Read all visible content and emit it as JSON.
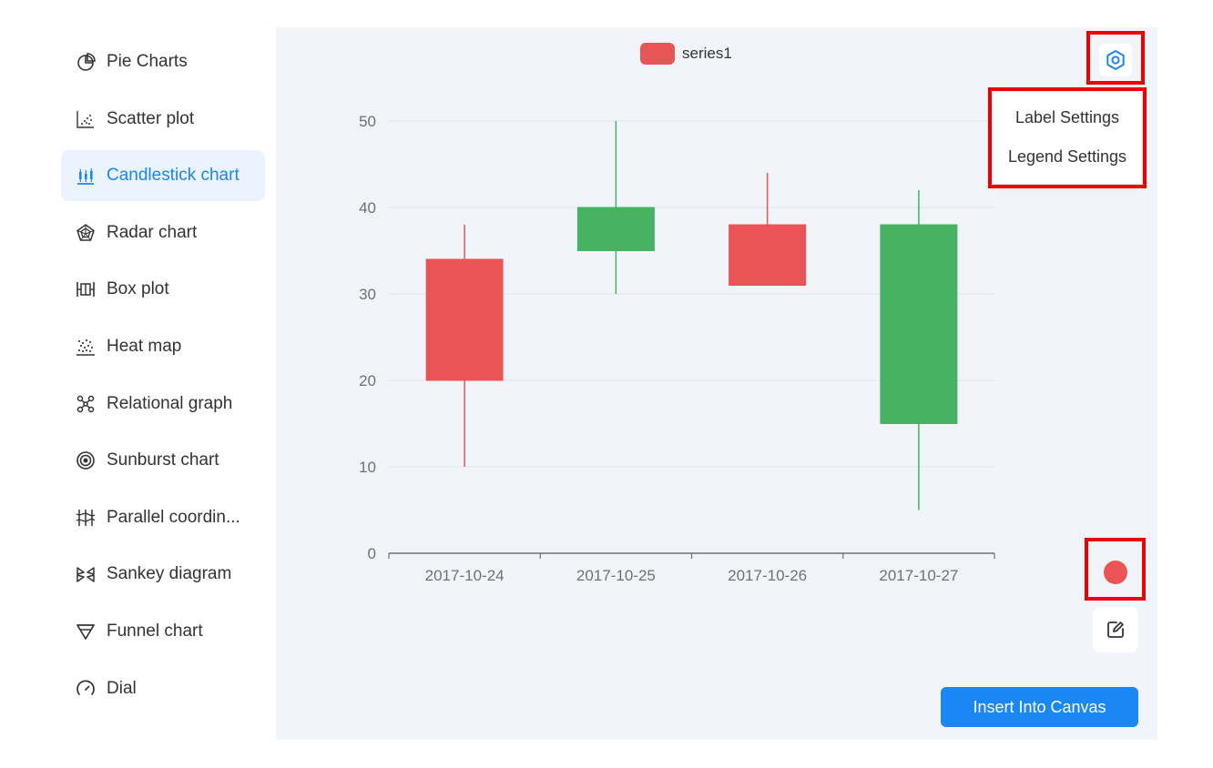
{
  "sidebar": {
    "items": [
      {
        "label": "Pie Charts",
        "icon": "pie-chart-icon",
        "active": false
      },
      {
        "label": "Scatter plot",
        "icon": "scatter-plot-icon",
        "active": false
      },
      {
        "label": "Candlestick chart",
        "icon": "candlestick-icon",
        "active": true
      },
      {
        "label": "Radar chart",
        "icon": "radar-chart-icon",
        "active": false
      },
      {
        "label": "Box plot",
        "icon": "box-plot-icon",
        "active": false
      },
      {
        "label": "Heat map",
        "icon": "heat-map-icon",
        "active": false
      },
      {
        "label": "Relational graph",
        "icon": "relational-graph-icon",
        "active": false
      },
      {
        "label": "Sunburst chart",
        "icon": "sunburst-icon",
        "active": false
      },
      {
        "label": "Parallel coordin...",
        "icon": "parallel-coordinates-icon",
        "active": false
      },
      {
        "label": "Sankey diagram",
        "icon": "sankey-icon",
        "active": false
      },
      {
        "label": "Funnel chart",
        "icon": "funnel-icon",
        "active": false
      },
      {
        "label": "Dial",
        "icon": "dial-icon",
        "active": false
      }
    ]
  },
  "settings_menu": {
    "label_settings": "Label Settings",
    "legend_settings": "Legend Settings"
  },
  "actions": {
    "insert_label": "Insert Into Canvas",
    "series_color": "#ea5455"
  },
  "colors": {
    "accent": "#1b87f5",
    "up": "#47b262",
    "down": "#eb5454",
    "highlight": "#ee0000"
  },
  "chart_data": {
    "type": "candlestick",
    "categories": [
      "2017-10-24",
      "2017-10-25",
      "2017-10-26",
      "2017-10-27"
    ],
    "series": [
      {
        "name": "series1",
        "values": [
          {
            "open": 20,
            "close": 34,
            "low": 10,
            "high": 38
          },
          {
            "open": 40,
            "close": 35,
            "low": 30,
            "high": 50
          },
          {
            "open": 31,
            "close": 38,
            "low": 33,
            "high": 44
          },
          {
            "open": 38,
            "close": 15,
            "low": 5,
            "high": 42
          }
        ]
      }
    ],
    "ylim": [
      0,
      50
    ],
    "yticks": [
      0,
      10,
      20,
      30,
      40,
      50
    ],
    "grid": true,
    "legend": "top-center"
  }
}
